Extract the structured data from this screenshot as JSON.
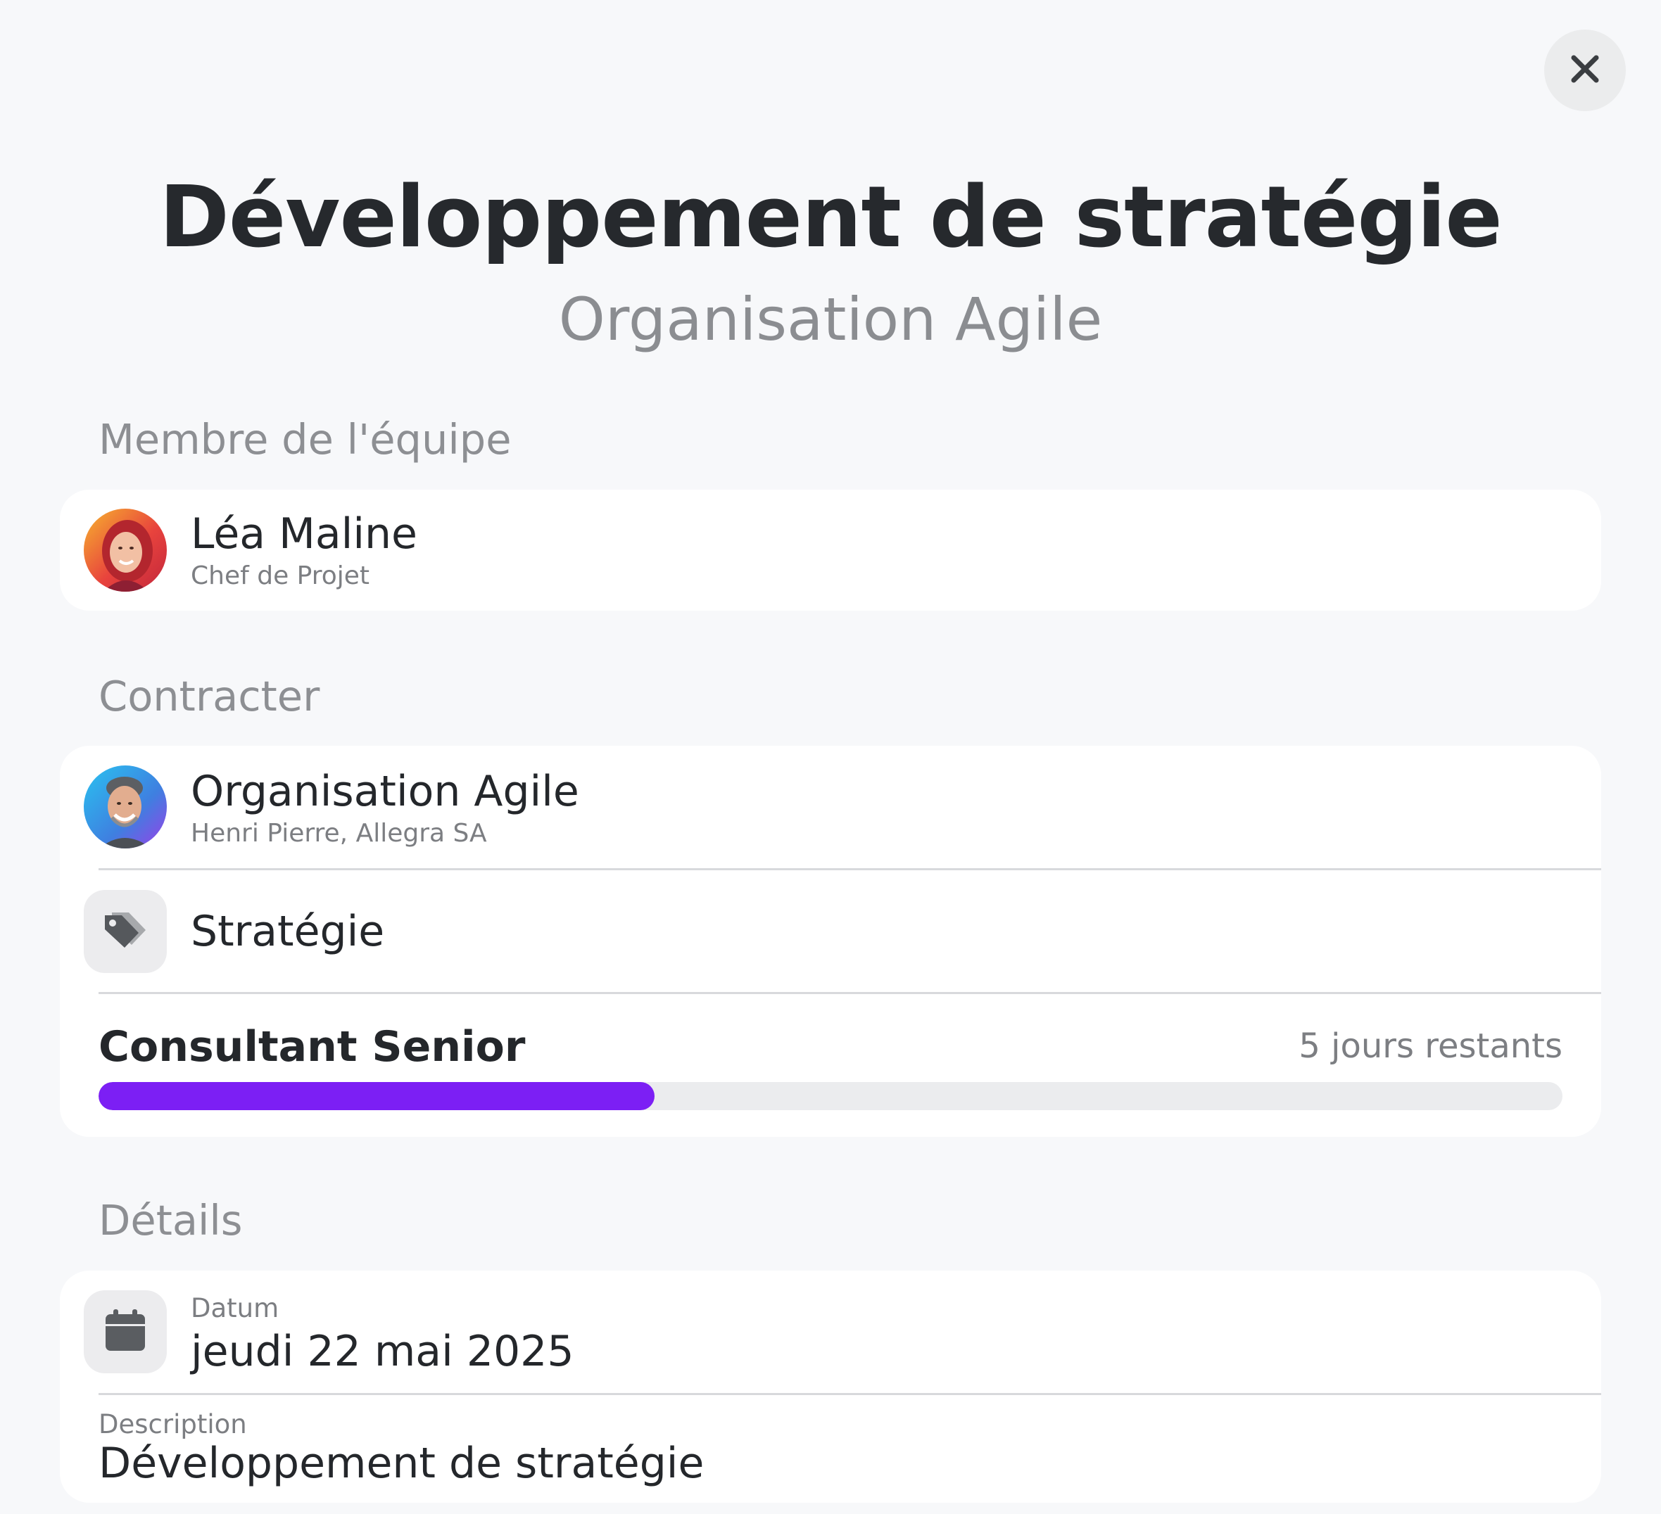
{
  "modal": {
    "title": "Développement de stratégie",
    "subtitle": "Organisation Agile",
    "close_icon": "close-icon"
  },
  "team": {
    "label": "Membre de l'équipe",
    "member": {
      "name": "Léa Maline",
      "role": "Chef de Projet",
      "avatar_colors": [
        "#f7b52e",
        "#e8433d",
        "#c2263c"
      ]
    }
  },
  "contracter": {
    "label": "Contracter",
    "organization": {
      "name": "Organisation Agile",
      "contact": "Henri Pierre, Allegra SA",
      "avatar_colors": [
        "#29c3f0",
        "#3f7fe0",
        "#9b3fe8"
      ]
    },
    "category": {
      "icon": "tag-icon",
      "label": "Stratégie"
    },
    "budget": {
      "title": "Consultant Senior",
      "remaining": "5 jours restants",
      "progress": 0.38,
      "progress_color": "#7c1ff4"
    }
  },
  "details": {
    "label": "Détails",
    "date": {
      "icon": "calendar-icon",
      "label": "Datum",
      "value": "jeudi 22 mai 2025"
    },
    "description": {
      "label": "Description",
      "value": "Développement de stratégie"
    }
  }
}
